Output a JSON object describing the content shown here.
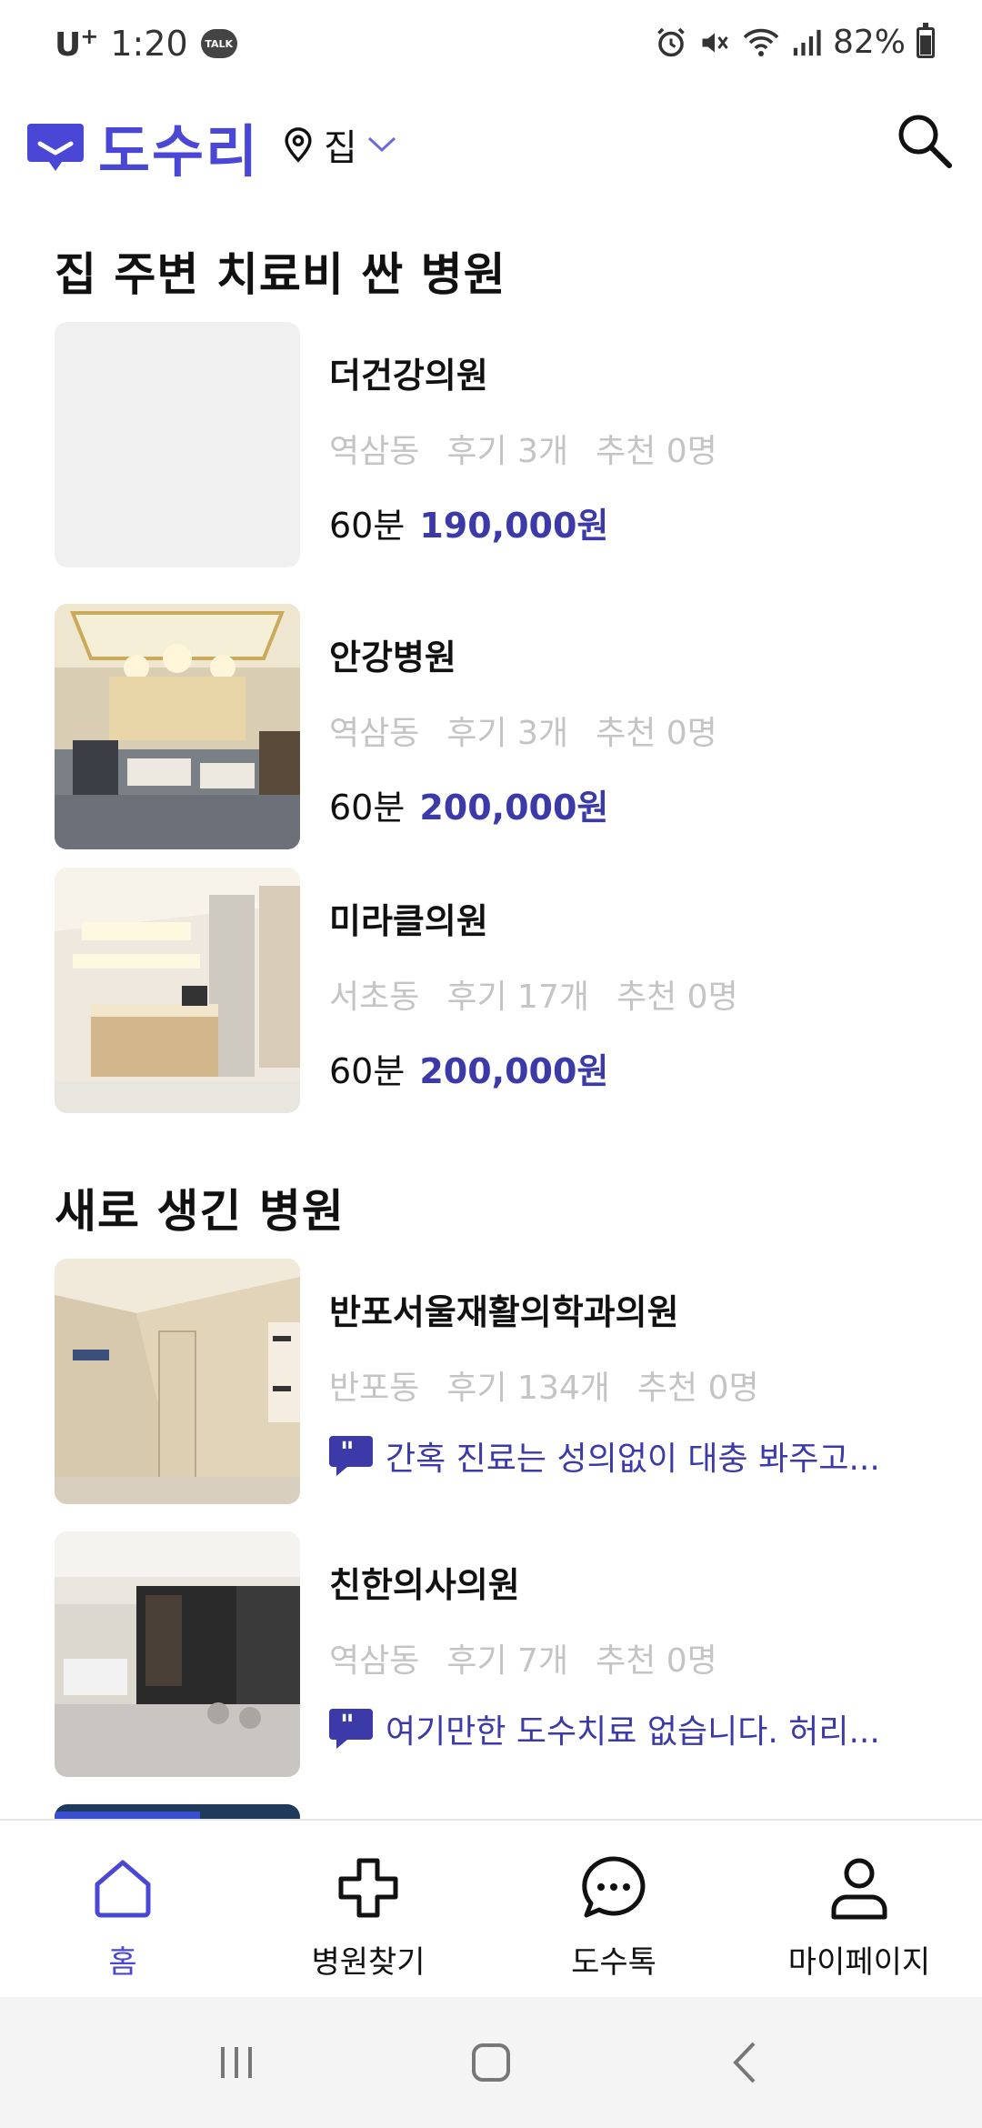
{
  "status_bar": {
    "carrier": "U",
    "carrier_sup": "+",
    "time": "1:20",
    "talk_badge": "TALK",
    "battery": "82%",
    "battery_level": 0.82
  },
  "header": {
    "app_name": "도수리",
    "location": "집"
  },
  "section_cheap": {
    "title": "집 주변 치료비 싼 병원",
    "items": [
      {
        "name": "더건강의원",
        "area": "역삼동",
        "reviews": "후기 3개",
        "recommend": "추천 0명",
        "duration": "60분",
        "price": "190,000원"
      },
      {
        "name": "안강병원",
        "area": "역삼동",
        "reviews": "후기 3개",
        "recommend": "추천 0명",
        "duration": "60분",
        "price": "200,000원"
      },
      {
        "name": "미라클의원",
        "area": "서초동",
        "reviews": "후기 17개",
        "recommend": "추천 0명",
        "duration": "60분",
        "price": "200,000원"
      }
    ]
  },
  "section_new": {
    "title": "새로 생긴 병원",
    "items": [
      {
        "name": "반포서울재활의학과의원",
        "area": "반포동",
        "reviews": "후기 134개",
        "recommend": "추천 0명",
        "review_snippet": "간혹 진료는 성의없이 대충 봐주고..."
      },
      {
        "name": "친한의사의원",
        "area": "역삼동",
        "reviews": "후기 7개",
        "recommend": "추천 0명",
        "review_snippet": "여기만한 도수치료 없습니다. 허리..."
      }
    ]
  },
  "bottom_nav": {
    "items": [
      {
        "label": "홈",
        "icon": "home-icon"
      },
      {
        "label": "병원찾기",
        "icon": "plus-cross-icon"
      },
      {
        "label": "도수톡",
        "icon": "chat-bubble-icon"
      },
      {
        "label": "마이페이지",
        "icon": "person-icon"
      }
    ]
  },
  "colors": {
    "accent": "#4b47d6",
    "price": "#3b3aa8",
    "meta_gray": "#c4c4c4"
  }
}
